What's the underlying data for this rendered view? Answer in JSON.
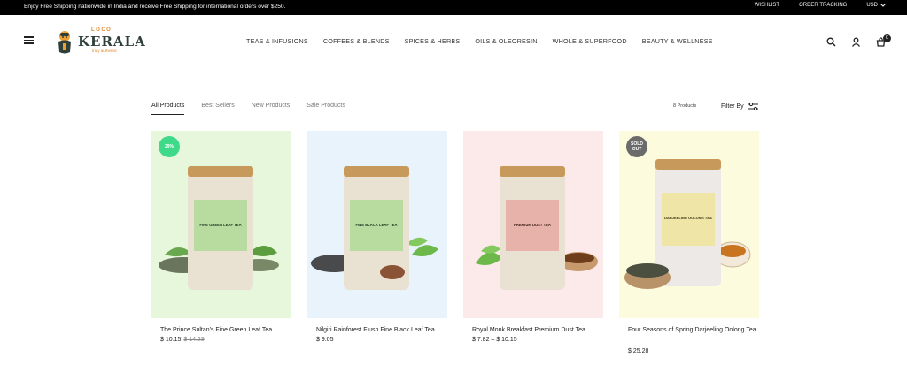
{
  "announcement": "Enjoy Free Shipping nationwide in India and receive Free Shipping for international orders over $250.",
  "topbar_links": {
    "wishlist": "WISHLIST",
    "order_tracking": "ORDER TRACKING",
    "currency": "USD"
  },
  "logo": {
    "loco": "LOCO",
    "kerala": "KERALA",
    "tagline": "truly authentic"
  },
  "nav": [
    "TEAS & INFUSIONS",
    "COFFEES & BLENDS",
    "SPICES & HERBS",
    "OILS & OLEORESIN",
    "WHOLE & SUPERFOOD",
    "BEAUTY & WELLNESS"
  ],
  "header_icons": [
    "search-icon",
    "user-icon",
    "cart-icon"
  ],
  "cart_count": "0",
  "tabs": [
    "All Products",
    "Best Sellers",
    "New Products",
    "Sale Products"
  ],
  "product_count": "8 Products",
  "filter_label": "Filter By",
  "colors": {
    "card_backgrounds": [
      "#e7f7dc",
      "#e8f3fc",
      "#fce9ea",
      "#fcfbdd"
    ],
    "sale_badge": "#3fd98a",
    "sold_out_badge": "#6b6b6b"
  },
  "products": [
    {
      "name": "The Prince Sultan's Fine Green Leaf Tea",
      "price": "$ 10.15",
      "old_price": "$ 14.29",
      "badge": "29%",
      "label": "FINE GREEN LEAF TEA",
      "label_color": "#9ccf7c"
    },
    {
      "name": "Nilgiri Rainforest Flush Fine Black Leaf Tea",
      "price": "$ 9.05",
      "old_price": "",
      "badge": "",
      "label": "FINE BLACK LEAF TEA",
      "label_color": "#9ccf7c"
    },
    {
      "name": "Royal Monk Breakfast Premium Dust Tea",
      "price": "$ 7.82 – $ 10.15",
      "old_price": "",
      "badge": "",
      "label": "PREMIUM DUST TEA",
      "label_color": "#d98a84"
    },
    {
      "name": "Four Seasons of Spring Darjeeling Oolong Tea",
      "price": "$ 25.28",
      "old_price": "",
      "badge": "SOLD OUT",
      "label": "DARJEELING OOLONG TEA",
      "label_color": "#e5d98e"
    }
  ]
}
